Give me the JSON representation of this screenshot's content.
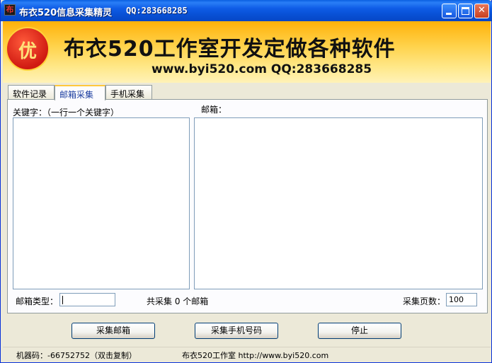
{
  "window": {
    "title": "布衣520信息采集精灵",
    "title_qq": "QQ:283668285",
    "app_icon": "布"
  },
  "banner": {
    "badge": "优",
    "title": "布衣520工作室开发定做各种软件",
    "subtitle": "www.byi520.com QQ:283668285"
  },
  "tabs": [
    {
      "label": "软件记录",
      "active": false
    },
    {
      "label": "邮箱采集",
      "active": true
    },
    {
      "label": "手机采集",
      "active": false
    }
  ],
  "panel": {
    "keywords_label": "关键字：（一行一个关键字）",
    "emails_label": "邮箱：",
    "keywords_value": "",
    "emails_value": "",
    "email_type_label": "邮箱类型：",
    "email_type_value": "",
    "total_label": "共采集 0 个邮箱",
    "pages_label": "采集页数：",
    "pages_value": "100"
  },
  "buttons": {
    "collect_email": "采集邮箱",
    "collect_phone": "采集手机号码",
    "stop": "停止"
  },
  "status": {
    "machine_code": "机器码：-66752752（双击复制）",
    "studio": "布衣520工作室 http://www.byi520.com"
  },
  "colors": {
    "titlebar": "#0a5fe0",
    "banner": "#ffc83c",
    "active_tab_text": "#1c3ea0"
  }
}
